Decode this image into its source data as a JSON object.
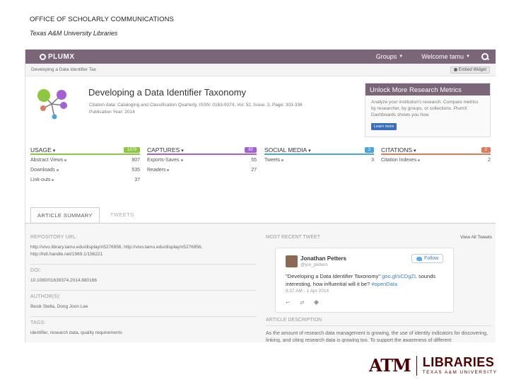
{
  "slide": {
    "title": "OFFICE OF SCHOLARLY COMMUNICATIONS",
    "subtitle": "Texas A&M University Libraries"
  },
  "topbar": {
    "brand": "PLUMX",
    "groups": "Groups",
    "welcome": "Welcome tamu",
    "color": "#7b6578"
  },
  "crumb": {
    "text": "Developing a Data Identifier Tax",
    "embed": "Embed Widget"
  },
  "article": {
    "title": "Developing a Data Identifier Taxonomy",
    "citation": "Citation data: Cataloging and Classification Quarterly, ISSN: 0163-9374, Vol: 52, Issue: 3, Page: 303-336",
    "pubyear": "Publication Year: 2014"
  },
  "promo": {
    "title": "Unlock More Research Metrics",
    "body": "Analyze your institution's research. Compare metrics by researcher, by groups, or collections. PlumX Dashboards shows you how.",
    "button": "Learn more"
  },
  "metrics": [
    {
      "label": "USAGE",
      "count": "1379",
      "color": "#8dc63f",
      "rows": [
        {
          "name": "Abstract Views",
          "value": "807"
        },
        {
          "name": "Downloads",
          "value": "535"
        },
        {
          "name": "Link-outs",
          "value": "37"
        }
      ]
    },
    {
      "label": "CAPTURES",
      "count": "82",
      "color": "#a35fd3",
      "rows": [
        {
          "name": "Exports-Saves",
          "value": "55"
        },
        {
          "name": "Readers",
          "value": "27"
        }
      ]
    },
    {
      "label": "SOCIAL MEDIA",
      "count": "3",
      "color": "#4aa3df",
      "rows": [
        {
          "name": "Tweets",
          "value": "3"
        }
      ]
    },
    {
      "label": "CITATIONS",
      "count": "2",
      "color": "#e07a5f",
      "rows": [
        {
          "name": "Citation Indexes",
          "value": "2"
        }
      ]
    }
  ],
  "tabs": {
    "summary": "ARTICLE SUMMARY",
    "tweets": "TWEETS"
  },
  "summary": {
    "repo_label": "REPOSITORY URL:",
    "repo_urls": "http://vivo.library.tamu.edu/display/n5276956, http://vivo.tamu.edu/display/n5276956, http://hdl.handle.net/1969.1/156221",
    "doi_label": "DOI:",
    "doi": "10.1080/01639374.2014.880166",
    "authors_label": "AUTHOR(S):",
    "authors": "Besik Stella, Dong Joon Lee",
    "tags_label": "TAGS:",
    "tags": "identifier, research data, quality requirements"
  },
  "tweet": {
    "section": "MOST RECENT TWEET",
    "view_all": "View All Tweets",
    "name": "Jonathan Petters",
    "handle": "@jon_petters",
    "follow": "Follow",
    "text_a": "\"Developing a Data Identifier Taxonomy\"",
    "link": "goo.gl/sCDgZL",
    "text_b": "sounds interesting, how influential will it be?",
    "hashtag": "#openData",
    "date": "8:37 AM - 1 Apr 2014"
  },
  "abstract": {
    "label": "ARTICLE DESCRIPTION",
    "text": "As the amount of research data management is growing, the use of identity indicators for discovering, linking, and citing research data is growing too. To support the awareness of different"
  },
  "logo": {
    "mark": "ATM",
    "word": "LIBRARIES",
    "sub": "TEXAS A&M UNIVERSITY",
    "color": "#500000"
  }
}
